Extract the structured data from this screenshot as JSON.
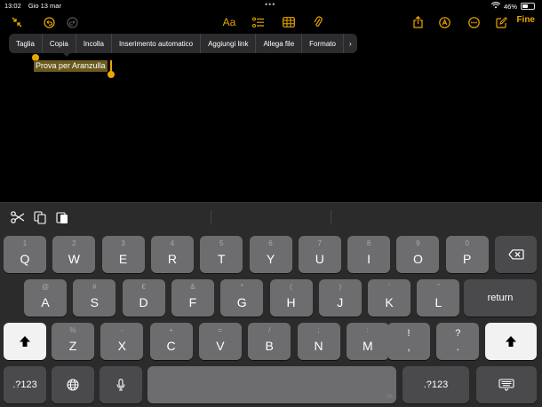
{
  "status": {
    "time": "13:02",
    "date": "Gio 13 mar",
    "battery_text": "46%",
    "battery_level": 0.46
  },
  "toolbar": {
    "format_label": "Aa",
    "done_label": "Fine",
    "accent_color": "#e9a700"
  },
  "edit_menu": {
    "items": [
      "Taglia",
      "Copia",
      "Incolla",
      "Inserimento automatico",
      "Aggiungi link",
      "Allega file",
      "Formato"
    ],
    "more_glyph": "›"
  },
  "note": {
    "selected_text": "Prova per Aranzulla"
  },
  "keyboard": {
    "row1": [
      {
        "main": "Q",
        "sub": "1"
      },
      {
        "main": "W",
        "sub": "2"
      },
      {
        "main": "E",
        "sub": "3"
      },
      {
        "main": "R",
        "sub": "4"
      },
      {
        "main": "T",
        "sub": "5"
      },
      {
        "main": "Y",
        "sub": "6"
      },
      {
        "main": "U",
        "sub": "7"
      },
      {
        "main": "I",
        "sub": "8"
      },
      {
        "main": "O",
        "sub": "9"
      },
      {
        "main": "P",
        "sub": "0"
      }
    ],
    "row2": [
      {
        "main": "A",
        "sub": "@"
      },
      {
        "main": "S",
        "sub": "#"
      },
      {
        "main": "D",
        "sub": "€"
      },
      {
        "main": "F",
        "sub": "&"
      },
      {
        "main": "G",
        "sub": "*"
      },
      {
        "main": "H",
        "sub": "("
      },
      {
        "main": "J",
        "sub": ")"
      },
      {
        "main": "K",
        "sub": "'"
      },
      {
        "main": "L",
        "sub": "\""
      }
    ],
    "row3": [
      {
        "main": "Z",
        "sub": "%"
      },
      {
        "main": "X",
        "sub": "-"
      },
      {
        "main": "C",
        "sub": "+"
      },
      {
        "main": "V",
        "sub": "="
      },
      {
        "main": "B",
        "sub": "/"
      },
      {
        "main": "N",
        "sub": ";"
      },
      {
        "main": "M",
        "sub": ":"
      }
    ],
    "punct": [
      {
        "main": ",",
        "sub": "!"
      },
      {
        "main": ".",
        "sub": "?"
      }
    ],
    "return_label": "return",
    "numbers_label": ".?123",
    "space_mark": "ITA"
  }
}
